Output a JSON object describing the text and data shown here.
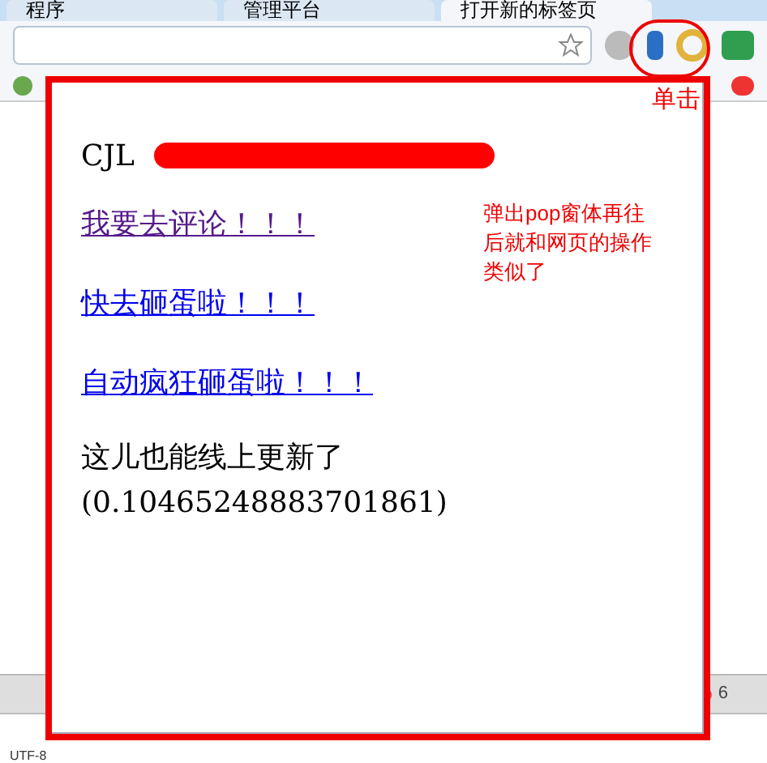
{
  "tabs": [
    {
      "label": "程序",
      "selected": false
    },
    {
      "label": "管理平台",
      "selected": false
    },
    {
      "label": "打开新的标签页",
      "selected": true
    }
  ],
  "popup": {
    "user": "CJL",
    "links": [
      {
        "text": "我要去评论！！！",
        "visited": true
      },
      {
        "text": "快去砸蛋啦！！！",
        "visited": false
      },
      {
        "text": "自动疯狂砸蛋啦！！！",
        "visited": false
      }
    ],
    "message": "这儿也能线上更新了",
    "value": "(0.10465248883701861)"
  },
  "annotations": {
    "click_label": "单击",
    "note": "弹出pop窗体再往后就和网页的操作类似了"
  },
  "devtools": {
    "error_count": "6"
  },
  "status_bar": {
    "encoding": "UTF-8"
  }
}
